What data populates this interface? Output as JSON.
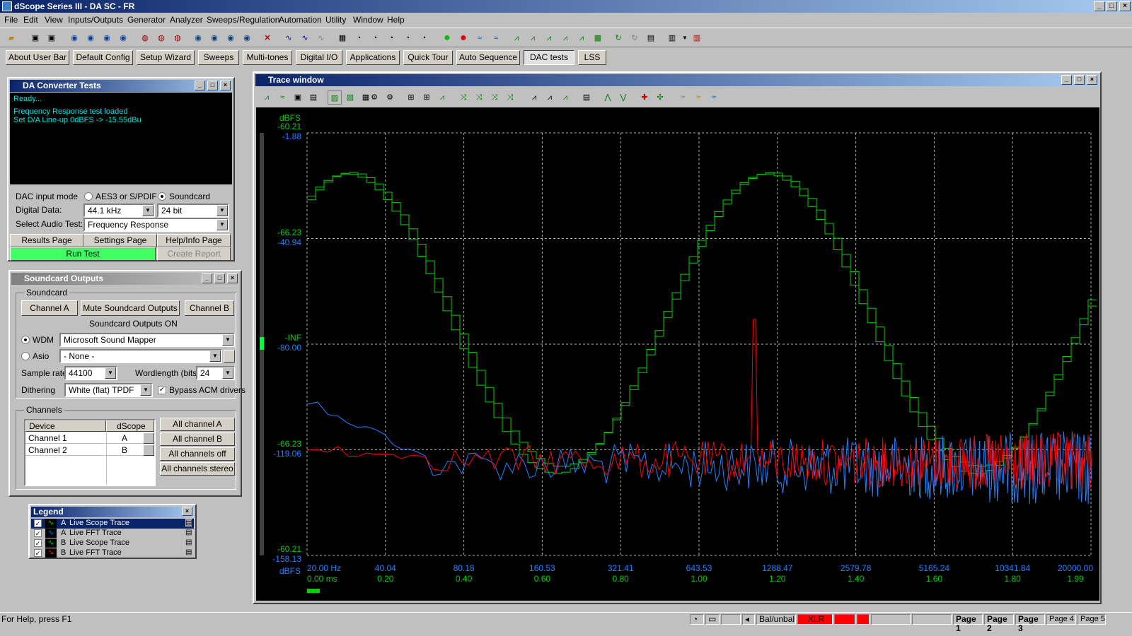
{
  "app": {
    "title": "dScope Series III - DA SC - FR"
  },
  "menu": [
    "File",
    "Edit",
    "View",
    "Inputs/Outputs",
    "Generator",
    "Analyzer",
    "Sweeps/Regulation",
    "Automation",
    "Utility",
    "Window",
    "Help"
  ],
  "userbar": [
    {
      "label": "About User Bar",
      "active": false
    },
    {
      "label": "Default Config",
      "active": false
    },
    {
      "label": "Setup Wizard",
      "active": false
    },
    {
      "label": "Sweeps",
      "active": false
    },
    {
      "label": "Multi-tones",
      "active": false
    },
    {
      "label": "Digital I/O",
      "active": false
    },
    {
      "label": "Applications",
      "active": false
    },
    {
      "label": "Quick Tour",
      "active": false
    },
    {
      "label": "Auto Sequence",
      "active": false
    },
    {
      "label": "DAC tests",
      "active": true
    },
    {
      "label": "LSS",
      "active": false
    }
  ],
  "da_tests": {
    "title": "DA Converter Tests",
    "console": [
      "Ready...",
      "Frequency Response test loaded",
      "Set D/A Line-up 0dBFS -> -15.55dBu"
    ],
    "dac_input_mode_label": "DAC input mode",
    "radio_aes": "AES3 or S/PDIF",
    "radio_soundcard": "Soundcard",
    "digital_data_label": "Digital Data:",
    "sample_rate": "44.1 kHz",
    "bit_depth": "24 bit",
    "select_test_label": "Select Audio Test:",
    "selected_test": "Frequency Response",
    "results_page": "Results Page",
    "settings_page": "Settings Page",
    "help_page": "Help/Info Page",
    "run_test": "Run Test",
    "create_report": "Create Report"
  },
  "soundcard": {
    "title": "Soundcard Outputs",
    "group_label": "Soundcard",
    "channel_a": "Channel A",
    "mute": "Mute Soundcard Outputs",
    "channel_b": "Channel B",
    "status": "Soundcard Outputs ON",
    "wdm_label": "WDM",
    "wdm_value": "Microsoft Sound Mapper",
    "asio_label": "Asio",
    "asio_value": "- None -",
    "sample_rate_label": "Sample rate",
    "sample_rate_value": "44100",
    "wordlength_label": "Wordlength (bits)",
    "wordlength_value": "24",
    "dithering_label": "Dithering",
    "dithering_value": "White (flat) TPDF",
    "bypass_label": "Bypass ACM drivers",
    "channels_label": "Channels",
    "col_device": "Device",
    "col_dscope": "dScope",
    "rows": [
      {
        "device": "Channel 1",
        "dscope": "A"
      },
      {
        "device": "Channel 2",
        "dscope": "B"
      }
    ],
    "all_a": "All channel A",
    "all_b": "All channel B",
    "all_off": "All channels off",
    "all_stereo": "All channels stereo"
  },
  "legend": {
    "title": "Legend",
    "items": [
      {
        "ch": "A",
        "name": "Live Scope Trace",
        "color": "#00c000",
        "selected": true
      },
      {
        "ch": "A",
        "name": "Live FFT Trace",
        "color": "#0060ff",
        "selected": false
      },
      {
        "ch": "B",
        "name": "Live Scope Trace",
        "color": "#00c000",
        "selected": false
      },
      {
        "ch": "B",
        "name": "Live FFT Trace",
        "color": "#ff0000",
        "selected": false
      }
    ]
  },
  "trace": {
    "title": "Trace window",
    "left_unit_top": "dBFS",
    "left_unit_bottom": "dBFS",
    "y_green": [
      "-60.21",
      "-66.23",
      "-INF",
      "-66.23",
      "-60.21"
    ],
    "y_blue": [
      "-1.88",
      "-40.94",
      "-80.00",
      "-119.06",
      "-158.13"
    ],
    "x_freq": [
      "20.00 Hz",
      "40.04",
      "80.18",
      "160.53",
      "321.41",
      "643.53",
      "1288.47",
      "2579.78",
      "5165.24",
      "10341.84",
      "20000.00"
    ],
    "x_time": [
      "0.00 ms",
      "0.20",
      "0.40",
      "0.60",
      "0.80",
      "1.00",
      "1.20",
      "1.40",
      "1.60",
      "1.80",
      "1.99"
    ],
    "colors": {
      "green": "#00d000",
      "blue": "#2080ff",
      "red": "#ff0000"
    }
  },
  "statusbar": {
    "help": "For Help, press F1",
    "balunbal": "Bal/unbal",
    "xlr": "XLR",
    "pages": [
      "Page 1",
      "Page 2",
      "Page 3",
      "Page 4",
      "Page 5"
    ]
  }
}
